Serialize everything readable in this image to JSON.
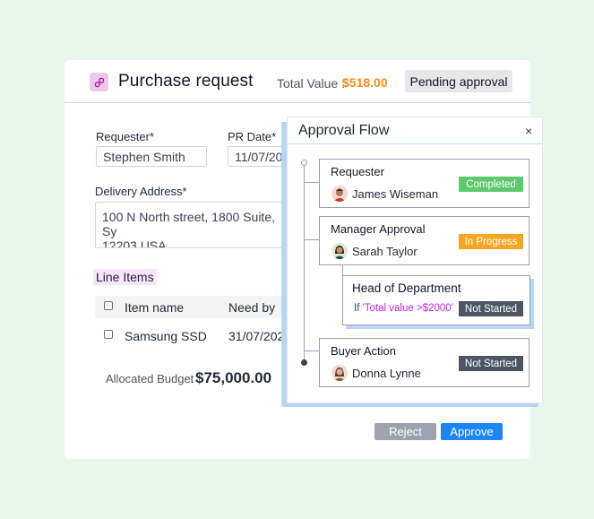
{
  "header": {
    "title": "Purchase request",
    "total_label": "Total Value :",
    "total_value": "$518.00",
    "status": "Pending approval"
  },
  "colors": {
    "accent": "#1d84f0",
    "completed": "#5fc96d",
    "in_progress": "#f6a623",
    "not_started": "#4b5563",
    "total": "#f08c1a"
  },
  "form": {
    "requester_label": "Requester*",
    "requester_value": "Stephen Smith",
    "pr_date_label": "PR Date*",
    "pr_date_value": "11/07/20",
    "address_label": "Delivery Address*",
    "address_line1": "100 N North street, 1800 Suite, Sy",
    "address_line2": "12203,USA"
  },
  "line_items": {
    "title": "Line Items",
    "columns": [
      "Item name",
      "Need by"
    ],
    "rows": [
      {
        "item": "Samsung SSD",
        "need_by": "31/07/202"
      }
    ]
  },
  "budget": {
    "label": "Allocated Budget",
    "value": "$75,000.00"
  },
  "actions": {
    "reject": "Reject",
    "approve": "Approve"
  },
  "approval_flow": {
    "title": "Approval Flow",
    "close": "×",
    "steps": [
      {
        "title": "Requester",
        "person": "James Wiseman",
        "status": "Completed"
      },
      {
        "title": "Manager Approval",
        "person": "Sarah Taylor",
        "status": "In Progress"
      },
      {
        "title": "Buyer Action",
        "person": "Donna Lynne",
        "status": "Not Started"
      }
    ],
    "sub_step": {
      "title": "Head of Department",
      "condition_prefix": "If",
      "condition": "'Total value >$2000'",
      "status": "Not Started"
    }
  },
  "icons": {
    "app": "link-icon",
    "close": "close-icon"
  }
}
